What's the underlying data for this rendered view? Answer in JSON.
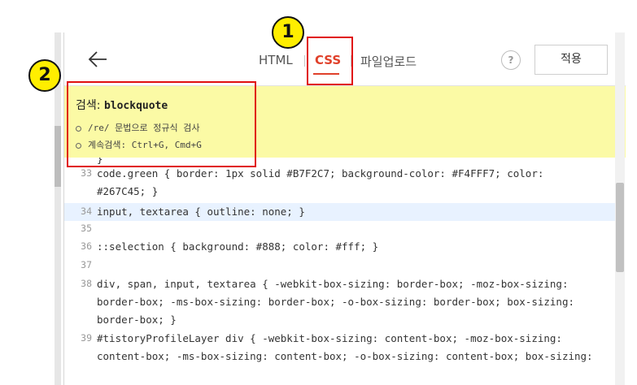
{
  "header": {
    "back_label": "",
    "tabs": [
      {
        "label": "HTML"
      },
      {
        "label": "CSS"
      },
      {
        "label": "파일업로드"
      }
    ],
    "help_label": "?",
    "apply_label": "적용"
  },
  "search": {
    "prefix": "검색: ",
    "keyword": "blockquote",
    "hints": [
      "/re/ 문법으로 정규식 검사",
      "계속검색: Ctrl+G, Cmd+G"
    ]
  },
  "editor": {
    "top_fragment": "}",
    "lines": [
      {
        "n": "33",
        "text": "code.green { border: 1px solid #B7F2C7; background-color: #F4FFF7; color:"
      },
      {
        "n": "",
        "text": "#267C45; }"
      },
      {
        "n": "34",
        "text": "input, textarea { outline: none; }",
        "active": true
      },
      {
        "n": "35",
        "text": ""
      },
      {
        "n": "36",
        "text": "::selection { background: #888; color: #fff; }"
      },
      {
        "n": "37",
        "text": ""
      },
      {
        "n": "38",
        "text": "div, span, input, textarea { -webkit-box-sizing: border-box; -moz-box-sizing:"
      },
      {
        "n": "",
        "text": "border-box; -ms-box-sizing: border-box; -o-box-sizing: border-box; box-sizing:"
      },
      {
        "n": "",
        "text": "border-box; }"
      },
      {
        "n": "39",
        "text": "#tistoryProfileLayer div { -webkit-box-sizing: content-box; -moz-box-sizing:"
      },
      {
        "n": "",
        "text": "content-box; -ms-box-sizing: content-box; -o-box-sizing: content-box; box-sizing:"
      }
    ]
  },
  "annotations": {
    "badge_1": "1",
    "badge_2": "2"
  },
  "colors": {
    "accent": "#e0402a",
    "search_banner": "#fbfaa5",
    "callout": "#e01010",
    "badge": "#ffee00"
  }
}
